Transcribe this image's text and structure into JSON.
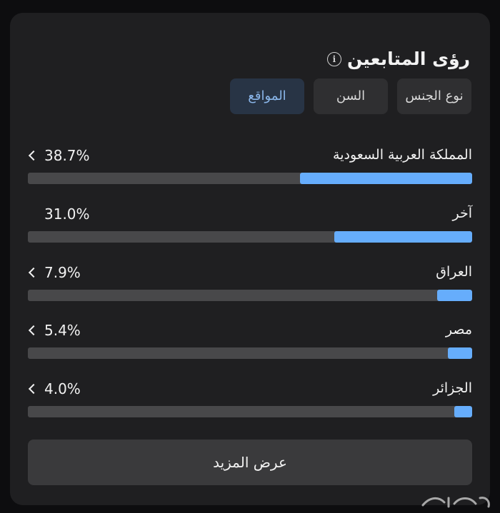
{
  "header": {
    "title": "رؤى المتابعين",
    "info_icon": "info-icon"
  },
  "tabs": [
    {
      "label": "نوع الجنس",
      "active": false
    },
    {
      "label": "السن",
      "active": false
    },
    {
      "label": "المواقع",
      "active": true
    }
  ],
  "locations": [
    {
      "name": "المملكة العربية السعودية",
      "value": "38.7%",
      "percent": 38.7,
      "expandable": true
    },
    {
      "name": "آخر",
      "value": "31.0%",
      "percent": 31.0,
      "expandable": false
    },
    {
      "name": "العراق",
      "value": "7.9%",
      "percent": 7.9,
      "expandable": true
    },
    {
      "name": "مصر",
      "value": "5.4%",
      "percent": 5.4,
      "expandable": true
    },
    {
      "name": "الجزائر",
      "value": "4.0%",
      "percent": 4.0,
      "expandable": true
    }
  ],
  "more_button": {
    "label": "عرض المزيد"
  },
  "colors": {
    "card_bg": "#1f1f21",
    "bar_track": "#48484a",
    "bar_fill": "#66adfc",
    "active_tab_text": "#8ab6ea"
  }
}
